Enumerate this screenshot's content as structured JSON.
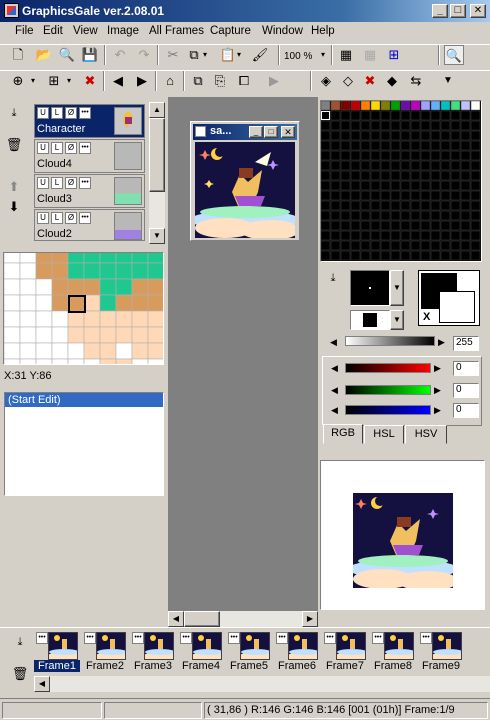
{
  "window": {
    "title": "GraphicsGale ver.2.08.01",
    "minimize": "_",
    "maximize": "□",
    "close": "✕"
  },
  "menu": [
    "File",
    "Edit",
    "View",
    "Image",
    "All Frames",
    "Capture",
    "Window",
    "Help"
  ],
  "toolbar": {
    "zoom_value": "100 %"
  },
  "layers": [
    {
      "name": "Character",
      "selected": true
    },
    {
      "name": "Cloud4",
      "selected": false
    },
    {
      "name": "Cloud3",
      "selected": false
    },
    {
      "name": "Cloud2",
      "selected": false
    }
  ],
  "layer_flags": [
    "U",
    "L",
    "Ø",
    "•••"
  ],
  "coords": "X:31 Y:86",
  "history": [
    "(Start Edit)"
  ],
  "document_window": {
    "title": "sa..."
  },
  "palette": {
    "top_colors": [
      "#808080",
      "#a0522d",
      "#800000",
      "#c00000",
      "#ff8000",
      "#ffd700",
      "#808000",
      "#00a000",
      "#6a0dad",
      "#c000c0",
      "#a0a0ff",
      "#60b0ff",
      "#00c0c0",
      "#40e080",
      "#c0c0ff",
      "#ffffff"
    ]
  },
  "color_panel": {
    "alpha_value": "255",
    "red_value": "0",
    "green_value": "0",
    "blue_value": "0",
    "transparent_mark": "X",
    "tabs": [
      "RGB",
      "HSL",
      "HSV"
    ]
  },
  "frames": [
    {
      "label": "Frame1",
      "selected": true
    },
    {
      "label": "Frame2",
      "selected": false
    },
    {
      "label": "Frame3",
      "selected": false
    },
    {
      "label": "Frame4",
      "selected": false
    },
    {
      "label": "Frame5",
      "selected": false
    },
    {
      "label": "Frame6",
      "selected": false
    },
    {
      "label": "Frame7",
      "selected": false
    },
    {
      "label": "Frame8",
      "selected": false
    },
    {
      "label": "Frame9",
      "selected": false
    }
  ],
  "frame_flag": "•••",
  "statusbar": {
    "info": "( 31,86 ) R:146 G:146 B:146  [001 (01h)]  Frame:1/9"
  }
}
